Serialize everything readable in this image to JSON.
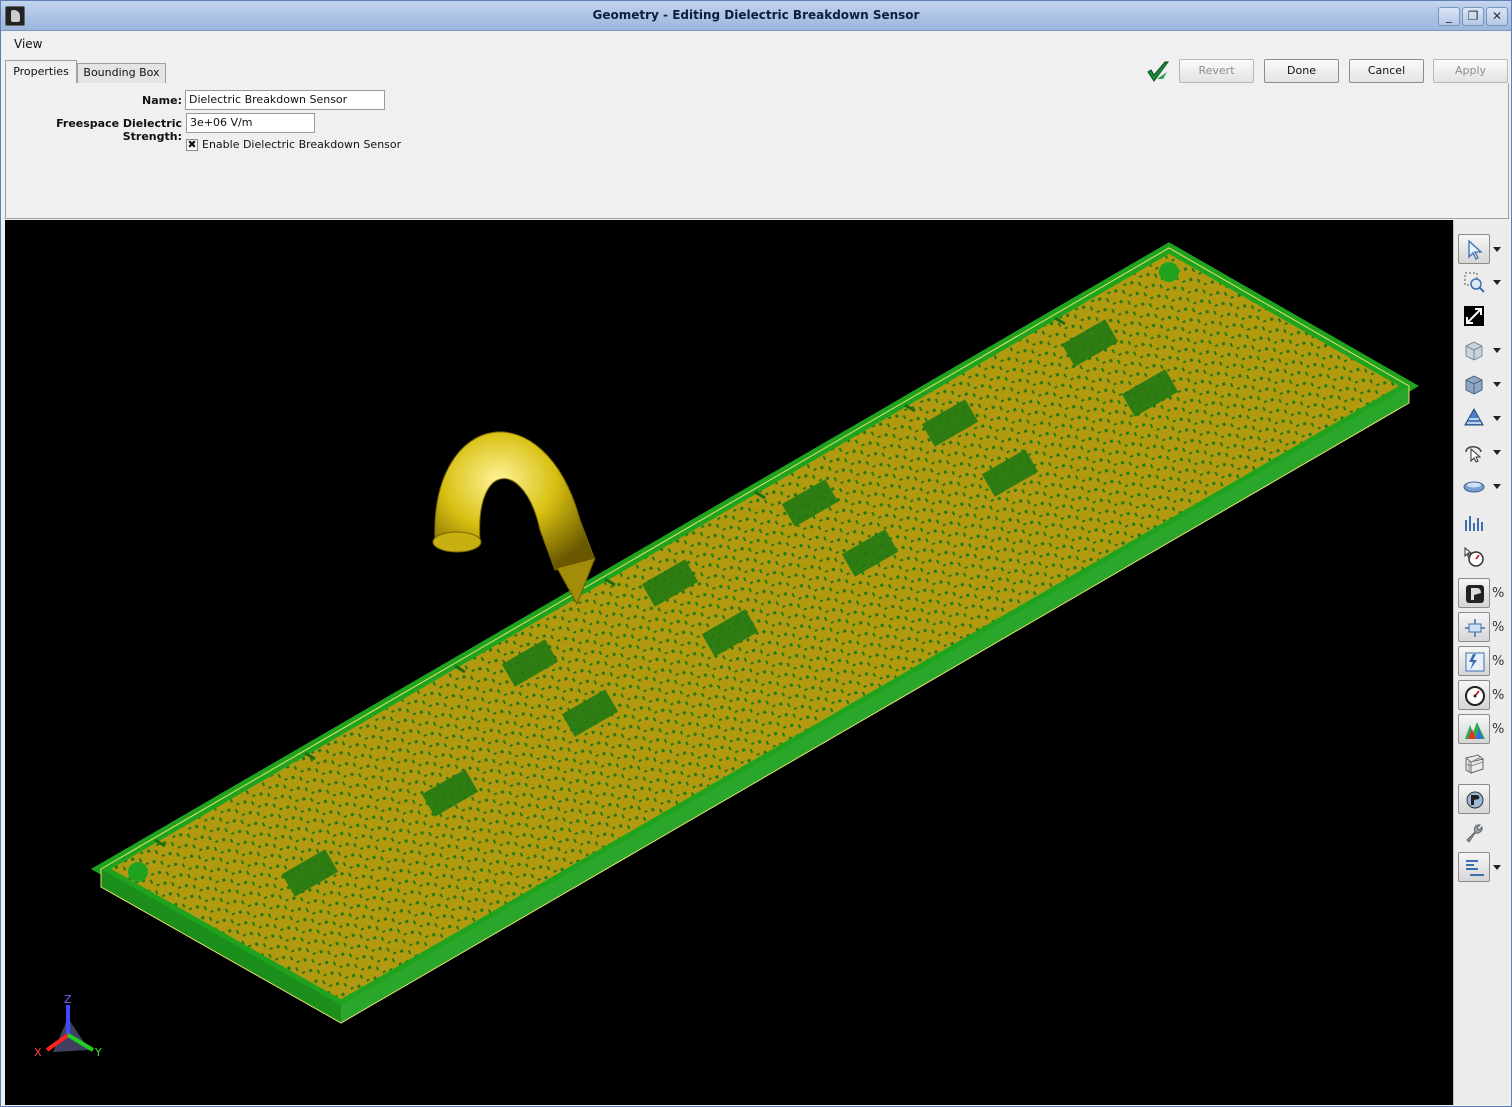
{
  "window": {
    "title": "Geometry - Editing Dielectric Breakdown Sensor",
    "controls": {
      "minimize": "_",
      "restore": "❐",
      "close": "✕"
    }
  },
  "menu": {
    "items": [
      "View"
    ]
  },
  "tabs": [
    {
      "label": "Properties",
      "active": true
    },
    {
      "label": "Bounding Box",
      "active": false
    }
  ],
  "actions": {
    "revert": {
      "label": "Revert",
      "enabled": false
    },
    "done": {
      "label": "Done",
      "enabled": true
    },
    "cancel": {
      "label": "Cancel",
      "enabled": true
    },
    "apply": {
      "label": "Apply",
      "enabled": false
    }
  },
  "form": {
    "name_label": "Name:",
    "name_value": "Dielectric Breakdown Sensor",
    "strength_label": "Freespace Dielectric Strength:",
    "strength_value": "3e+06 V/m",
    "enable_label": "Enable Dielectric Breakdown Sensor",
    "enable_checked": true,
    "check_mark": "✖"
  },
  "viewport": {
    "background": "#000000",
    "board_fill": "#b29a10",
    "board_edge": "#1f9a1f",
    "probe_color": "#d8c012",
    "axes": {
      "x": "X",
      "y": "Y",
      "z": "Z"
    }
  },
  "toolbar": {
    "tools": [
      "select-arrow-icon",
      "zoom-region-icon",
      "fit-view-icon",
      "box-view-icon",
      "solid-view-icon",
      "mesh-view-icon",
      "rotate-view-icon",
      "plane-view-icon",
      "bar-graph-icon",
      "sensor-gauge-icon",
      "geometry-display-icon",
      "circuit-component-icon",
      "lightning-source-icon",
      "meter-dial-icon",
      "field-plot-icon",
      "grid-mesh-icon",
      "material-display-icon",
      "wrench-icon",
      "text-align-icon"
    ],
    "percent_symbol": "%"
  }
}
